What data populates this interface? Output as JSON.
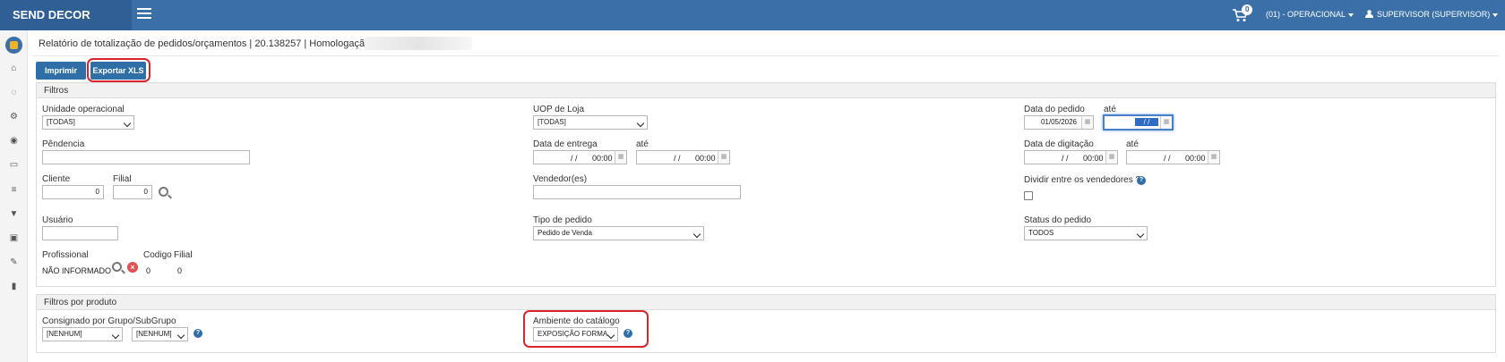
{
  "brand": "SEND DECOR",
  "header": {
    "cart_count": "0",
    "operational": "(01) - OPERACIONAL",
    "user": "SUPERVISOR (SUPERVISOR)"
  },
  "page": {
    "title": "Relatório de totalização de pedidos/orçamentos | 20.138257 | Homologação |"
  },
  "toolbar": {
    "print_label": "Imprimir",
    "export_label": "Exportar XLS"
  },
  "filters": {
    "title": "Filtros",
    "unidade_label": "Unidade operacional",
    "unidade_value": "[TODAS]",
    "uop_label": "UOP de Loja",
    "uop_value": "[TODAS]",
    "data_pedido_label": "Data do pedido",
    "ate1": "até",
    "data_pedido_from": "01/05/2026",
    "data_pedido_to": "/ /",
    "pendencia_label": "Pêndencia",
    "data_entrega_label": "Data de entrega",
    "ate2": "até",
    "data_entrega_from_date": "/ /",
    "data_entrega_from_time": "00:00",
    "data_entrega_to_date": "/ /",
    "data_entrega_to_time": "00:00",
    "data_digitacao_label": "Data de digitação",
    "ate3": "até",
    "data_digitacao_from_date": "/ /",
    "data_digitacao_from_time": "00:00",
    "data_digitacao_to_date": "/ /",
    "data_digitacao_to_time": "00:00",
    "cliente_label": "Cliente",
    "cliente_value": "0",
    "filial_label": "Filial",
    "filial_value": "0",
    "vendedor_label": "Vendedor(es)",
    "dividir_label": "Dividir entre os vendedores ?",
    "usuario_label": "Usuário",
    "tipo_pedido_label": "Tipo de pedido",
    "tipo_pedido_value": "Pedido de Venda",
    "status_pedido_label": "Status do pedido",
    "status_pedido_value": "TODOS",
    "profissional_label": "Profissional",
    "profissional_value": "NÃO INFORMADO",
    "codigo_label": "Codigo",
    "codigo_value": "0",
    "prof_filial_label": "Filial",
    "prof_filial_value": "0"
  },
  "product_filters": {
    "title": "Filtros por produto",
    "consignado_label": "Consignado por Grupo/SubGrupo",
    "grupo_value": "[NENHUM]",
    "subgrupo_value": "[NENHUM]",
    "ambiente_label": "Ambiente do catálogo",
    "ambiente_value": "EXPOSIÇÃO FORMA"
  },
  "icons": [
    "menu-icon",
    "cart-icon",
    "user-icon",
    "home-icon",
    "spinner-icon",
    "cogs-icon",
    "target-icon",
    "money-icon",
    "sliders-icon",
    "cart-icon",
    "image-icon",
    "wrench-icon",
    "chart-icon",
    "search-icon",
    "clear-icon",
    "help-icon",
    "calendar-icon"
  ],
  "colors": {
    "topbar": "#3a6fa8",
    "brand_bg": "#2f5f94",
    "button": "#2f6ea7",
    "highlight": "#d9232d"
  }
}
